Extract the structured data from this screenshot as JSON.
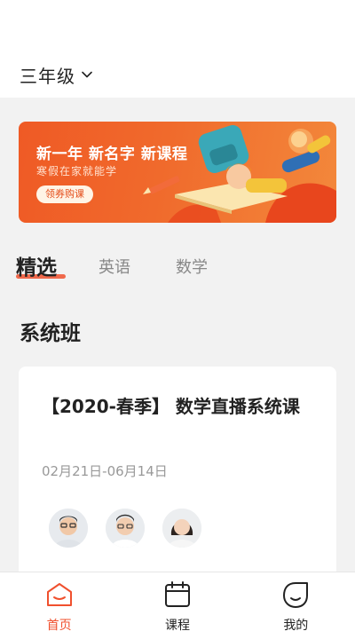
{
  "header": {
    "grade": "三年级"
  },
  "banner": {
    "title": "新一年 新名字 新课程",
    "subtitle": "寒假在家就能学",
    "button": "领券购课",
    "colors": {
      "accent": "#ef5a25"
    }
  },
  "tabs": [
    {
      "label": "精选",
      "active": true
    },
    {
      "label": "英语",
      "active": false
    },
    {
      "label": "数学",
      "active": false
    }
  ],
  "section": {
    "title": "系统班"
  },
  "course": {
    "title": "【2020-春季】 数学直播系统课",
    "date": "02月21日-06月14日",
    "teachers_count": 3
  },
  "bottom_nav": [
    {
      "label": "首页",
      "icon": "home-icon",
      "active": true
    },
    {
      "label": "课程",
      "icon": "calendar-icon",
      "active": false
    },
    {
      "label": "我的",
      "icon": "profile-icon",
      "active": false
    }
  ],
  "colors": {
    "primary": "#f0502e",
    "background": "#f2f2f2"
  }
}
